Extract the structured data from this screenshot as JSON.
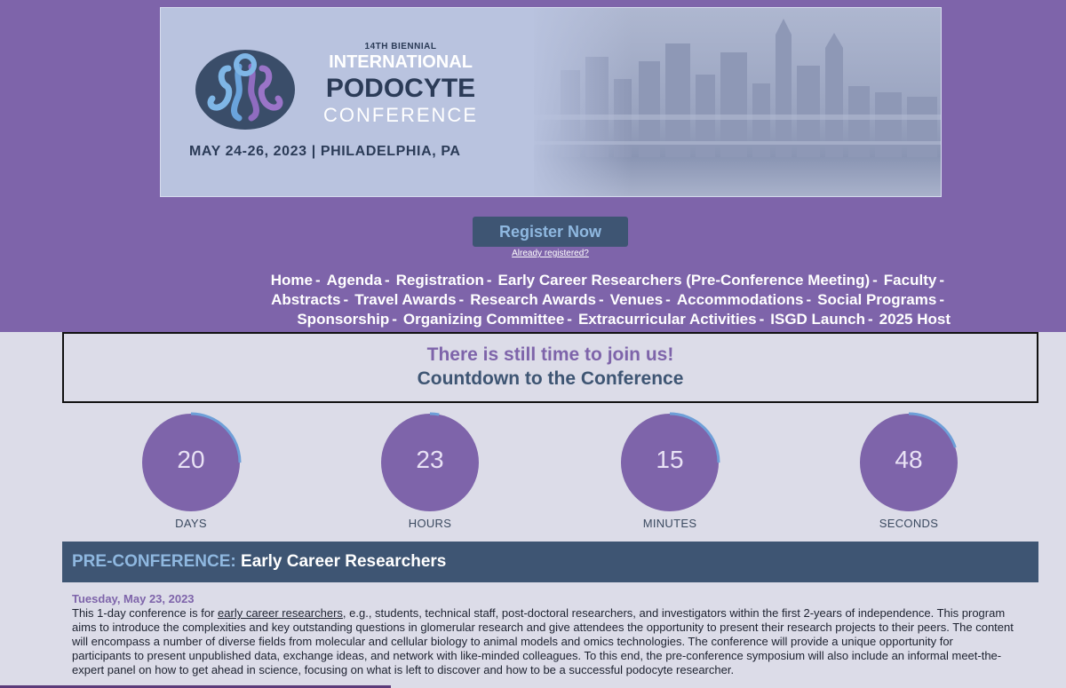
{
  "banner": {
    "edition": "14TH BIENNIAL",
    "line1": "INTERNATIONAL",
    "line2": "PODOCYTE",
    "line3": "CONFERENCE",
    "date_place": "MAY 24-26, 2023 | PHILADELPHIA, PA"
  },
  "register": {
    "button_label": "Register Now",
    "already_label": "Already registered?"
  },
  "nav": {
    "rows": [
      [
        "Home",
        "Agenda",
        "Registration",
        "Early Career Researchers (Pre-Conference Meeting)",
        "Faculty"
      ],
      [
        "Abstracts",
        "Travel Awards",
        "Research Awards",
        "Venues",
        "Accommodations",
        "Social Programs"
      ],
      [
        "Sponsorship",
        "Organizing Committee",
        "Extracurricular Activities",
        "ISGD Launch",
        "2025 Host"
      ]
    ]
  },
  "countdown": {
    "title": "There is still time to join us!",
    "subtitle": "Countdown to the Conference",
    "timers": [
      {
        "value": "20",
        "label": "DAYS",
        "progress": 0.25
      },
      {
        "value": "23",
        "label": "HOURS",
        "progress": 0.03
      },
      {
        "value": "15",
        "label": "MINUTES",
        "progress": 0.25
      },
      {
        "value": "48",
        "label": "SECONDS",
        "progress": 0.2
      }
    ]
  },
  "preconference": {
    "heading_accent": "PRE-CONFERENCE:",
    "heading_rest": "Early Career Researchers",
    "date": "Tuesday, May 23, 2023",
    "body_intro": "This 1-day conference is for ",
    "body_link": "early career researchers",
    "body_rest": ", e.g., students, technical staff, post-doctoral researchers, and investigators within the first 2-years of independence. This program aims to introduce the complexities and key outstanding questions in glomerular research and give attendees the opportunity to present their research projects to their peers. The content will encompass a number of diverse fields from molecular and cellular biology to animal models and omics technologies. The conference will provide a unique opportunity for participants to present unpublished data, exchange ideas, and network with like-minded colleagues. To this end, the pre-conference symposium will also include an informal meet-the-expert panel on how to get ahead in science, focusing on what is left to discover and how to be a successful podocyte researcher."
  },
  "colors": {
    "purple": "#7e64aa",
    "navy": "#3e5573",
    "light_blue": "#8fb8e0",
    "page_bg": "#dcdce8"
  }
}
